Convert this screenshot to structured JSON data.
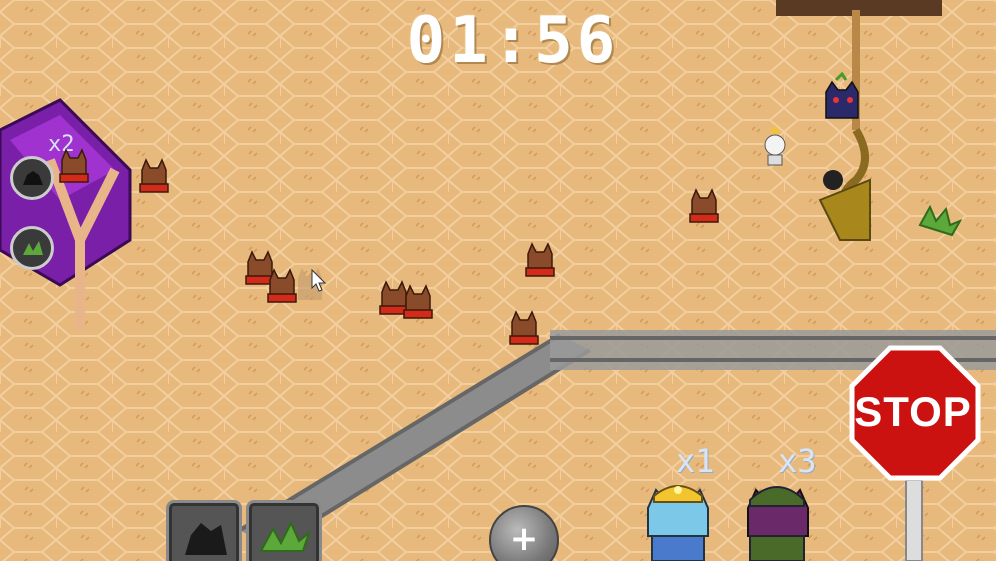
{
  "hud": {
    "timer": "01:56"
  },
  "units": {
    "miner_count": "x1",
    "soldier_count": "x3",
    "tower_count": "x2"
  },
  "signs": {
    "stop_label": "STOP"
  },
  "icons": {
    "coal": "coal-icon",
    "herb": "herb-icon",
    "add": "plus-icon",
    "cursor": "cursor-icon"
  },
  "colors": {
    "sand": "#e8b97c",
    "hex_line": "#f3cfa0",
    "track": "#8c8c8c",
    "stop_red": "#cc1111",
    "tower_purple": "#7a1fa8"
  }
}
